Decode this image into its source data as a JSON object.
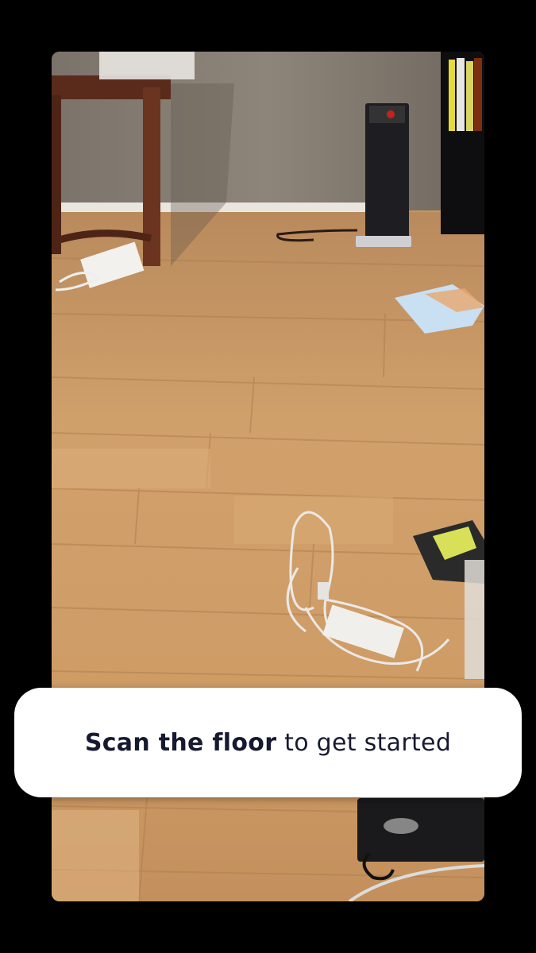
{
  "prompt": {
    "bold": "Scan the floor",
    "rest": " to get started"
  },
  "colors": {
    "background": "#000000",
    "card": "#ffffff",
    "text": "#161a30",
    "floor": "#c8945e",
    "wall": "#8a8178"
  },
  "icons": {
    "camera_feed": "room-floor-camera-view"
  }
}
